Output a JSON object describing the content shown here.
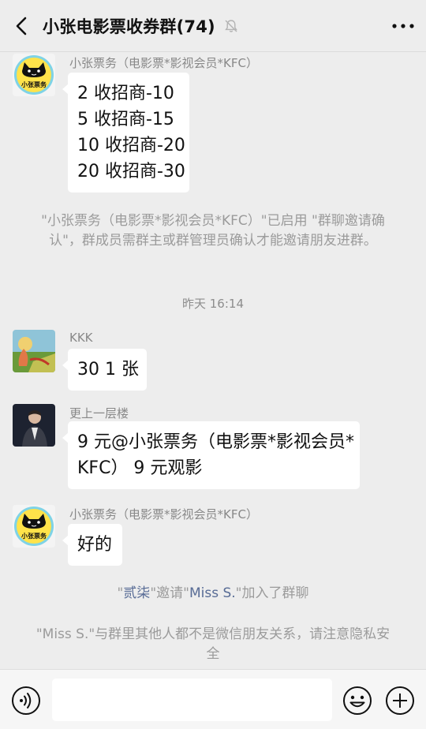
{
  "header": {
    "title": "小张电影票收券群(74)",
    "back_icon": "chevron-left-icon",
    "mute_icon": "bell-off-icon",
    "more_icon": "more-dots-icon"
  },
  "messages": [
    {
      "sender": "小张票务（电影票*影视会员*KFC）",
      "avatar_text": "小张票务",
      "lines": [
        "2 收招商-10",
        "5 收招商-15",
        "10 收招商-20",
        "20 收招商-30"
      ]
    },
    {
      "sender": "KKK",
      "lines": [
        "30  1 张"
      ]
    },
    {
      "sender": "更上一层楼",
      "lines": [
        "9 元@小张票务（电影票*影视会员*",
        "KFC）  9 元观影"
      ]
    },
    {
      "sender": "小张票务（电影票*影视会员*KFC）",
      "avatar_text": "小张票务",
      "lines": [
        "好的"
      ]
    }
  ],
  "system": {
    "invite_confirm": "\"小张票务（电影票*影视会员*KFC）\"已启用 \"群聊邀请确认\"，群成员需群主或群管理员确认才能邀请朋友进群。",
    "timestamp": "昨天 16:14",
    "invite_name1": "贰柒",
    "invite_mid": "邀请",
    "invite_name2": "Miss S.",
    "invite_tail": "加入了群聊",
    "quote": "\"",
    "privacy": "\"Miss S.\"与群里其他人都不是微信朋友关系，请注意隐私安全"
  },
  "input_bar": {
    "voice_icon": "voice-icon",
    "emoji_icon": "emoji-icon",
    "plus_icon": "plus-icon",
    "value": ""
  },
  "colors": {
    "background": "#ededed",
    "bubble": "#ffffff",
    "system_text": "#9b9b9b",
    "link": "#576b95",
    "avatar_yellow": "#ffe34a",
    "avatar_ring": "#7fd3e6"
  }
}
